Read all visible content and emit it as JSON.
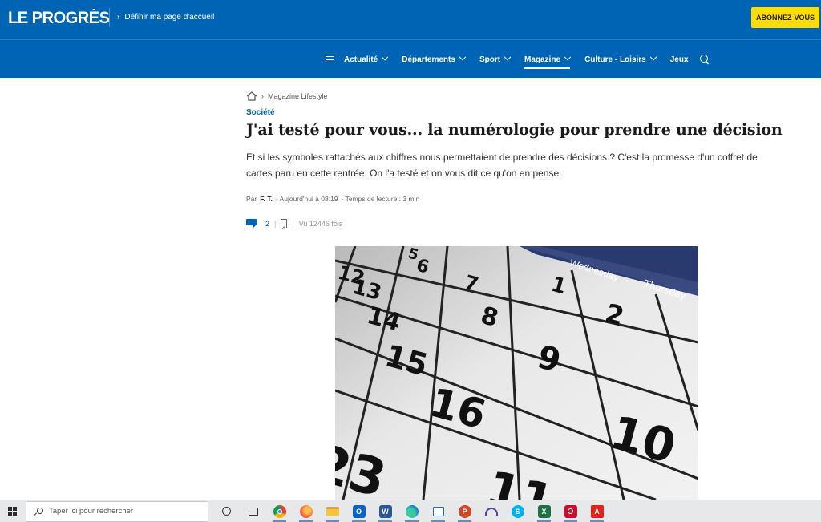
{
  "header": {
    "logo": "LE PROGRÈS",
    "home_link": "Définir ma page d'accueil",
    "subscribe": "ABONNEZ-VOUS"
  },
  "nav": {
    "items": [
      {
        "label": "Actualité",
        "dropdown": true
      },
      {
        "label": "Départements",
        "dropdown": true
      },
      {
        "label": "Sport",
        "dropdown": true
      },
      {
        "label": "Magazine",
        "dropdown": true,
        "active": true
      },
      {
        "label": "Culture - Loisirs",
        "dropdown": true
      },
      {
        "label": "Jeux",
        "dropdown": false
      }
    ]
  },
  "article": {
    "breadcrumb": "Magazine Lifestyle",
    "category": "Société",
    "title": "J'ai testé pour vous... la numérologie pour prendre une décision",
    "lede": "Et si les symboles rattachés aux chiffres nous permettaient de prendre des décisions ? C'est la promesse d'un coffret de cartes paru en cette rentrée. On l'a testé et on vous dit ce qu'on en pense.",
    "meta": {
      "by": "Par",
      "author": "F. T.",
      "date": "- Aujourd'hui à 08:19",
      "reading": "- Temps de lecture : 3 min"
    },
    "comments_count": "2",
    "views": "Vu 12446 fois",
    "image_labels": {
      "wednesday": "Wednesday",
      "thursday": "Thursday",
      "numbers": [
        "5",
        "6",
        "7",
        "1",
        "2",
        "12",
        "13",
        "8",
        "14",
        "9",
        "15",
        "16",
        "10",
        "23",
        "11"
      ]
    }
  },
  "taskbar": {
    "search_placeholder": "Taper ici pour rechercher",
    "apps": [
      "task-view",
      "chrome",
      "firefox",
      "file-explorer",
      "outlook",
      "word",
      "edge",
      "app-window",
      "powerpoint",
      "headset",
      "skype",
      "excel",
      "screen-recorder",
      "acrobat"
    ]
  },
  "colors": {
    "brand_blue": "#0064b4",
    "subscribe_yellow": "#ffdd00"
  }
}
